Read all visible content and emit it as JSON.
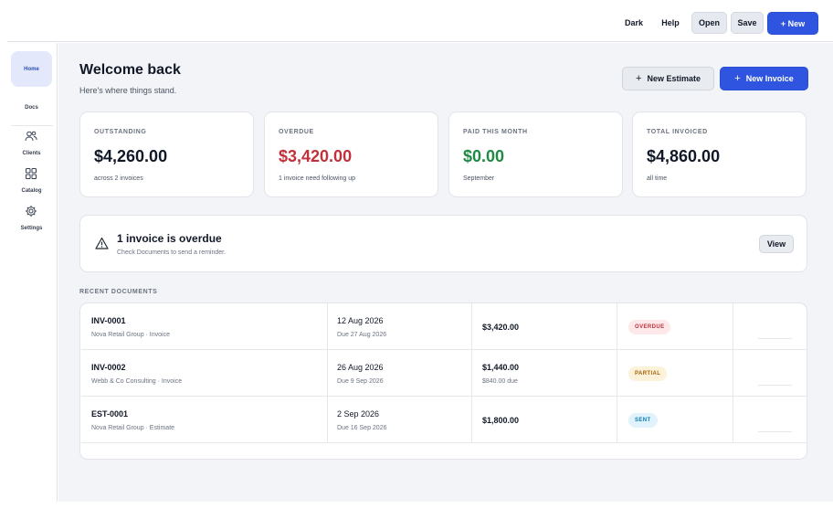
{
  "topbar": {
    "dark_label": "Dark",
    "help_label": "Help",
    "open_label": "Open",
    "save_label": "Save",
    "new_label": "+ New"
  },
  "sidebar": {
    "items": [
      {
        "label": "Home",
        "icon": "home-icon"
      },
      {
        "label": "Docs",
        "icon": "docs-icon"
      },
      {
        "label": "Clients",
        "icon": "users-icon"
      },
      {
        "label": "Catalog",
        "icon": "grid-icon"
      },
      {
        "label": "Settings",
        "icon": "gear-icon"
      }
    ]
  },
  "header": {
    "title": "Welcome back",
    "subtitle": "Here's where things stand.",
    "new_estimate_label": "New Estimate",
    "new_invoice_label": "New Invoice",
    "plus": "+"
  },
  "stats": [
    {
      "label": "OUTSTANDING",
      "value": "$4,260.00",
      "sub": "across 2 invoices",
      "color": "#111827"
    },
    {
      "label": "OVERDUE",
      "value": "$3,420.00",
      "sub": "1 invoice need following up",
      "color": "#c0313b"
    },
    {
      "label": "PAID THIS MONTH",
      "value": "$0.00",
      "sub": "September",
      "color": "#1f8a44"
    },
    {
      "label": "TOTAL INVOICED",
      "value": "$4,860.00",
      "sub": "all time",
      "color": "#111827"
    }
  ],
  "alert": {
    "title": "1 invoice is overdue",
    "subtitle": "Check Documents to send a reminder.",
    "view_label": "View",
    "icon": "warning-icon"
  },
  "recent": {
    "title": "RECENT DOCUMENTS",
    "rows": [
      {
        "id": "INV-0001",
        "client": "Nova Retail Group · Invoice",
        "date": "12 Aug 2026",
        "due": "Due 27 Aug 2026",
        "amount": "$3,420.00",
        "amount_sub": "",
        "status": "OVERDUE",
        "status_bg": "#fde8ea",
        "status_fg": "#c0313b"
      },
      {
        "id": "INV-0002",
        "client": "Webb & Co Consulting · Invoice",
        "date": "26 Aug 2026",
        "due": "Due 9 Sep 2026",
        "amount": "$1,440.00",
        "amount_sub": "$840.00 due",
        "status": "PARTIAL",
        "status_bg": "#fcf1d9",
        "status_fg": "#a16207"
      },
      {
        "id": "EST-0001",
        "client": "Nova Retail Group · Estimate",
        "date": "2 Sep 2026",
        "due": "Due 16 Sep 2026",
        "amount": "$1,800.00",
        "amount_sub": "",
        "status": "SENT",
        "status_bg": "#e0f2fb",
        "status_fg": "#0b7bb0"
      }
    ]
  },
  "colors": {
    "accent": "#2f55e0",
    "background": "#f3f4f7"
  }
}
